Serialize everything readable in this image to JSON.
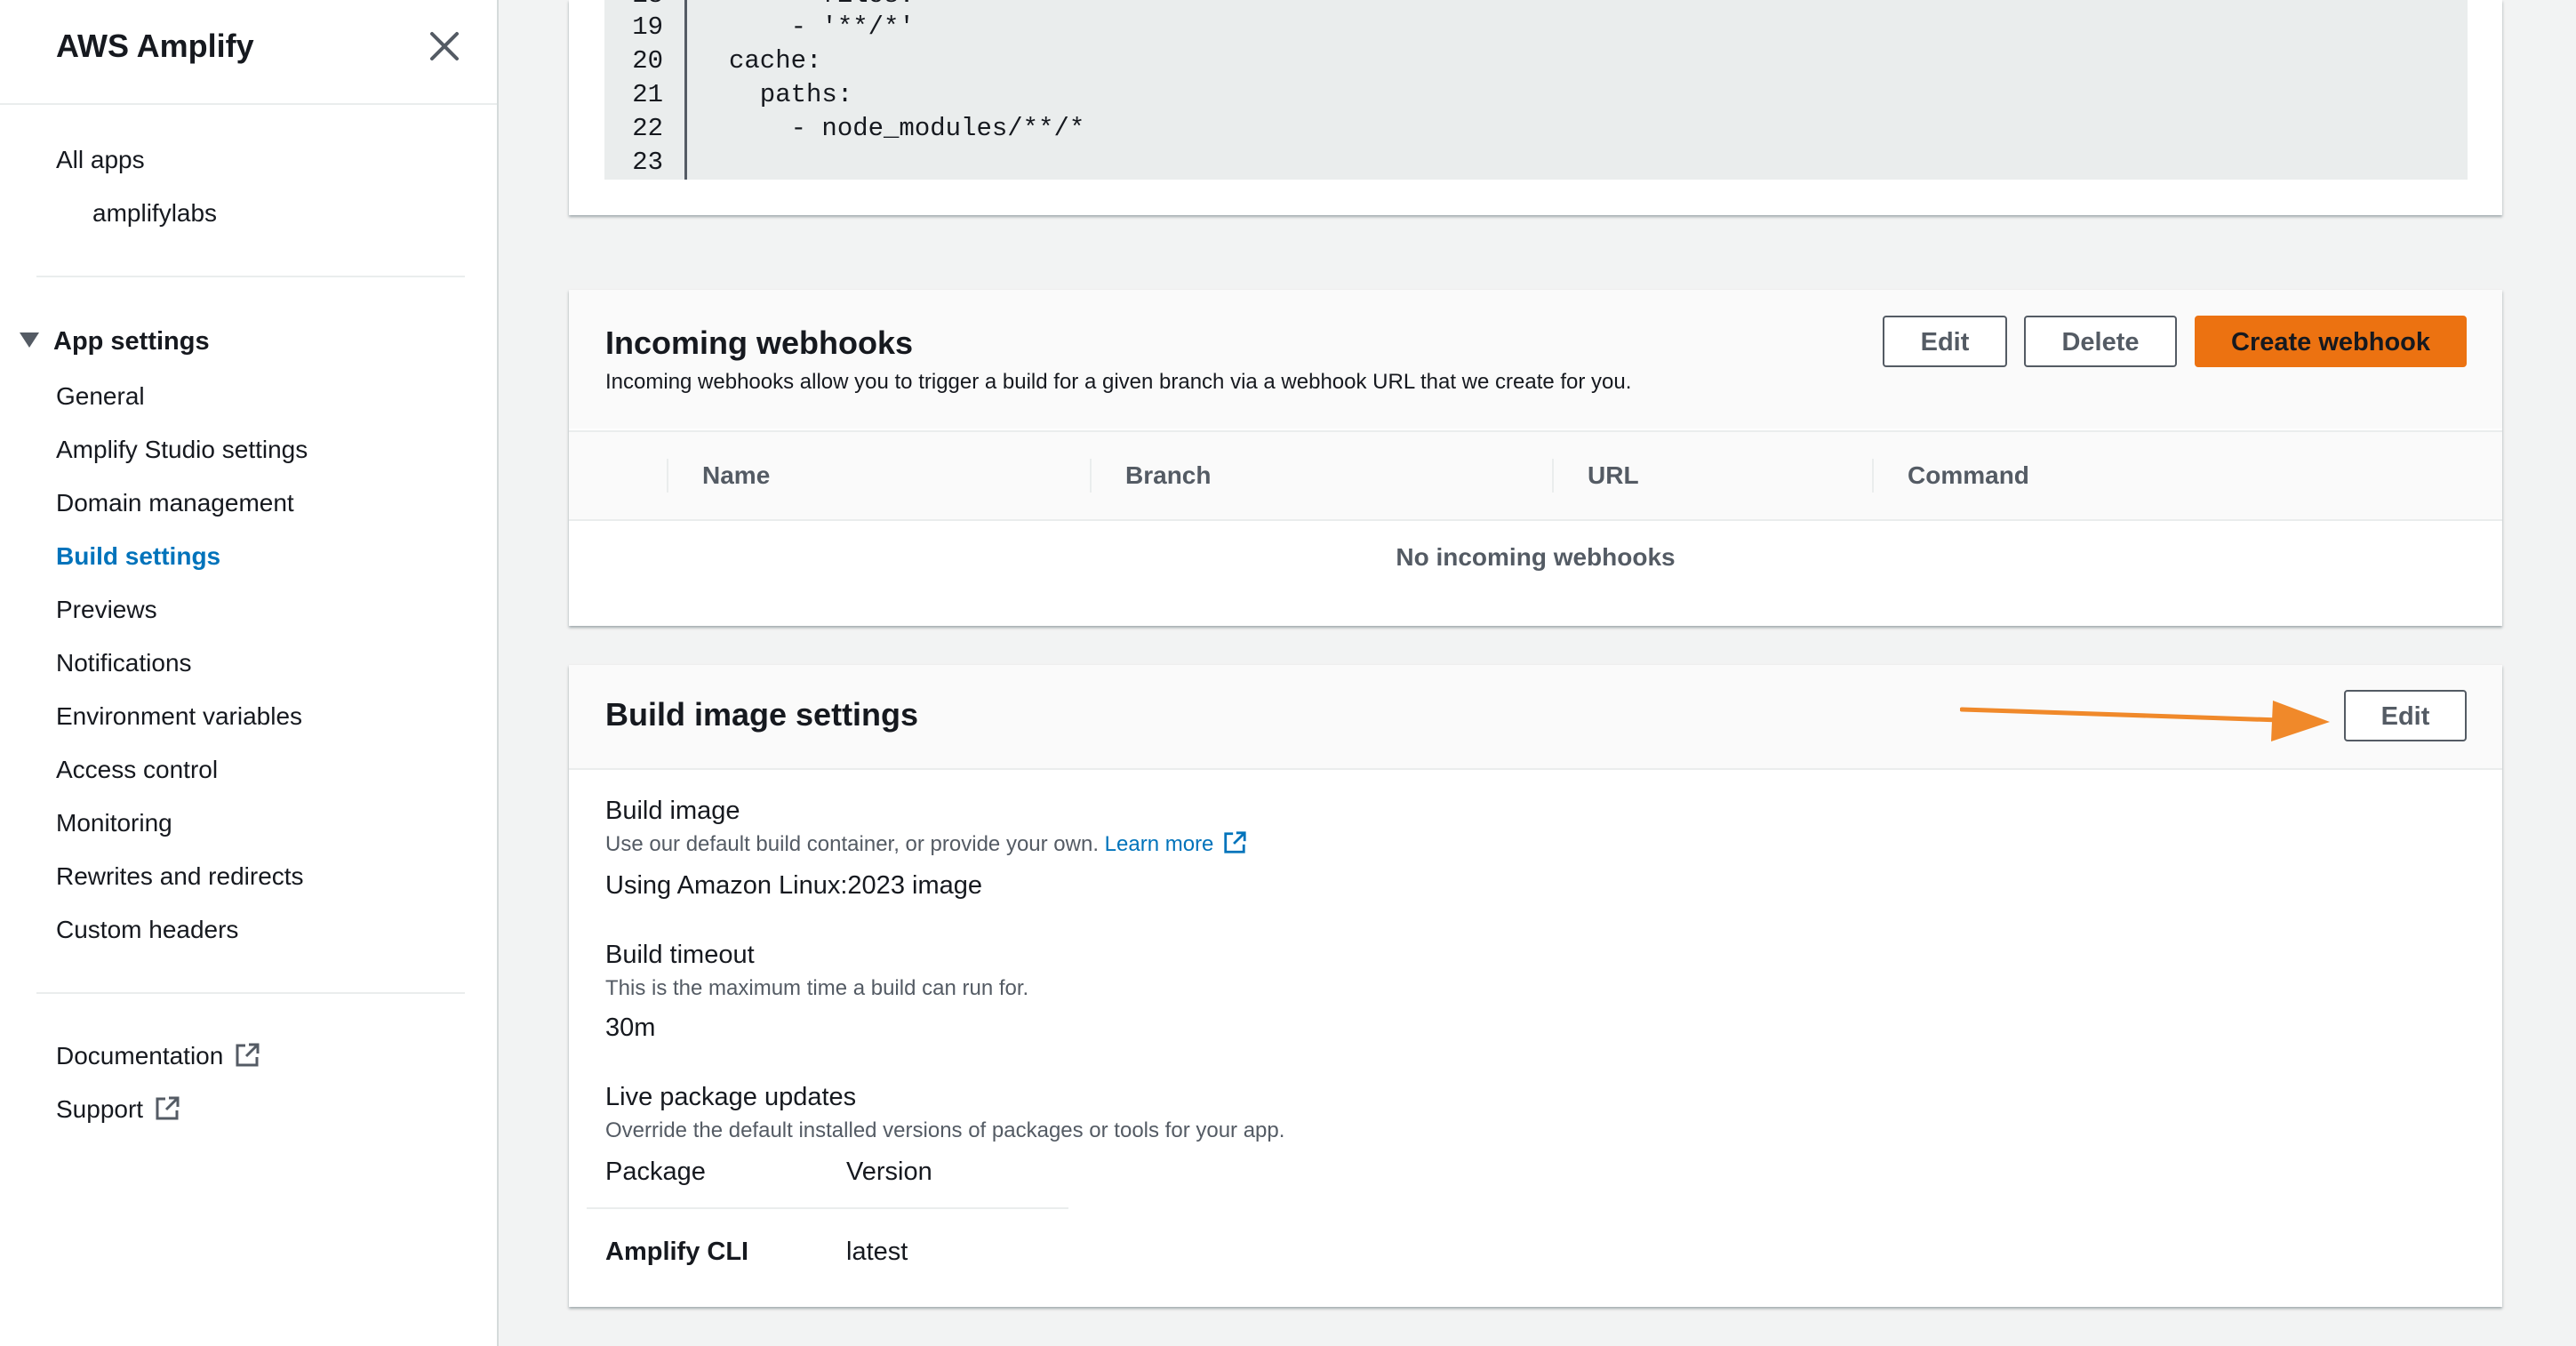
{
  "sidebar": {
    "title": "AWS Amplify",
    "all_apps": "All apps",
    "app_name": "amplifylabs",
    "section_title": "App settings",
    "items": [
      {
        "label": "General"
      },
      {
        "label": "Amplify Studio settings"
      },
      {
        "label": "Domain management"
      },
      {
        "label": "Build settings",
        "active": true
      },
      {
        "label": "Previews"
      },
      {
        "label": "Notifications"
      },
      {
        "label": "Environment variables"
      },
      {
        "label": "Access control"
      },
      {
        "label": "Monitoring"
      },
      {
        "label": "Rewrites and redirects"
      },
      {
        "label": "Custom headers"
      }
    ],
    "documentation": "Documentation",
    "support": "Support"
  },
  "code": {
    "partial_first_line": "      files:",
    "lines": [
      {
        "num": "19",
        "text": "    - '**/*'"
      },
      {
        "num": "20",
        "text": "cache:"
      },
      {
        "num": "21",
        "text": "  paths:"
      },
      {
        "num": "22",
        "text": "    - node_modules/**/*"
      },
      {
        "num": "23",
        "text": ""
      }
    ]
  },
  "webhooks": {
    "title": "Incoming webhooks",
    "description": "Incoming webhooks allow you to trigger a build for a given branch via a webhook URL that we create for you.",
    "edit_label": "Edit",
    "delete_label": "Delete",
    "create_label": "Create webhook",
    "columns": [
      "Name",
      "Branch",
      "URL",
      "Command"
    ],
    "empty_text": "No incoming webhooks"
  },
  "build_image": {
    "title": "Build image settings",
    "edit_label": "Edit",
    "image_label": "Build image",
    "image_desc": "Use our default build container, or provide your own.",
    "learn_more": "Learn more",
    "image_value": "Using Amazon Linux:2023 image",
    "timeout_label": "Build timeout",
    "timeout_desc": "This is the maximum time a build can run for.",
    "timeout_value": "30m",
    "live_label": "Live package updates",
    "live_desc": "Override the default installed versions of packages or tools for your app.",
    "table_headers": [
      "Package",
      "Version"
    ],
    "packages": [
      {
        "name": "Amplify CLI",
        "version": "latest"
      }
    ]
  },
  "colors": {
    "accent": "#0073bb",
    "primary_button": "#ec7211",
    "arrow": "#f0892a"
  }
}
